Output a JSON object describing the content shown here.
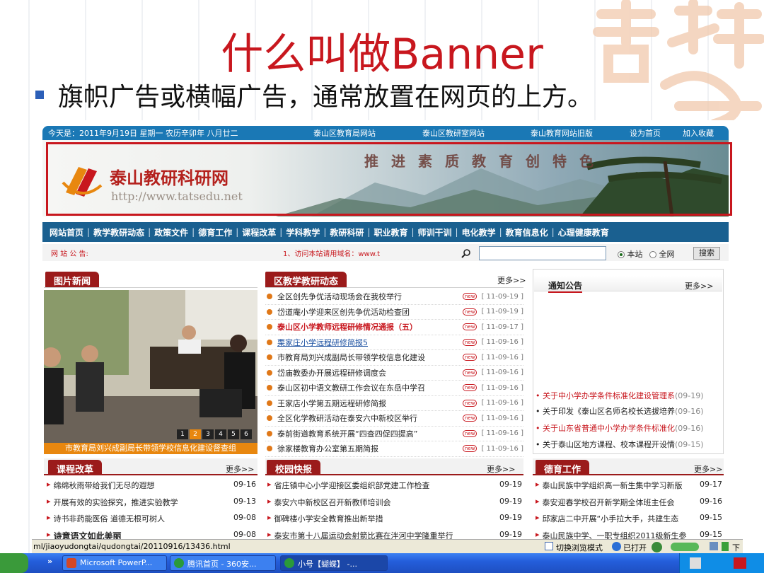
{
  "slide": {
    "title": "什么叫做Banner",
    "bullet": "旗帜广告或横幅广告，通常放置在网页的上方。"
  },
  "site": {
    "topbar": {
      "date": "今天是：2011年9月19日  星期一  农历辛卯年 八月廿二",
      "links": [
        "泰山区教育局网站",
        "泰山区教研室网站",
        "泰山教育网站旧版",
        "设为首页",
        "加入收藏"
      ]
    },
    "banner": {
      "name": "泰山教研科研网",
      "url": "http://www.tatsedu.net",
      "slogan": "推进素质教育创特色"
    },
    "nav": [
      "网站首页",
      "教学教研动态",
      "政策文件",
      "德育工作",
      "课程改革",
      "学科教学",
      "教研科研",
      "职业教育",
      "师训干训",
      "电化教学",
      "教育信息化",
      "心理健康教育"
    ],
    "notice": {
      "label": "网 站 公 告:",
      "text": "1、访问本站请用域名：www.t",
      "scope_site": "本站",
      "scope_web": "全网",
      "search": "搜索"
    },
    "photo_news": {
      "header": "图片新闻",
      "caption": "市教育局刘兴成副局长带领学校信息化建设督查组",
      "pages": [
        "1",
        "2",
        "3",
        "4",
        "5",
        "6"
      ]
    },
    "district_news": {
      "header": "区教学教研动态",
      "more": "更多>>",
      "new_label": "new",
      "items": [
        {
          "title": "全区创先争优活动现场会在我校举行",
          "date": "[ 11-09-19 ]"
        },
        {
          "title": "岱道庵小学迎来区创先争优活动检查团",
          "date": "[ 11-09-19 ]"
        },
        {
          "title": "泰山区小学教师远程研修情况通报（五）",
          "date": "[ 11-09-17 ]"
        },
        {
          "title": "栗家庄小学远程研修简报5",
          "date": "[ 11-09-16 ]"
        },
        {
          "title": "市教育局刘兴成副局长带领学校信息化建设",
          "date": "[ 11-09-16 ]"
        },
        {
          "title": "岱庙教委办开展远程研修调度会",
          "date": "[ 11-09-16 ]"
        },
        {
          "title": "泰山区初中语文教研工作会议在东岳中学召",
          "date": "[ 11-09-16 ]"
        },
        {
          "title": "王家店小学第五期远程研修简报",
          "date": "[ 11-09-16 ]"
        },
        {
          "title": "全区化学教研活动在泰安六中新校区举行",
          "date": "[ 11-09-16 ]"
        },
        {
          "title": "泰前街道教育系统开展“四查四促四提高”",
          "date": "[ 11-09-16 ]"
        },
        {
          "title": "徐家楼教育办公室第五期简报",
          "date": "[ 11-09-16 ]"
        }
      ]
    },
    "announcements": {
      "header": "通知公告",
      "more": "更多>>",
      "items": [
        {
          "title": "• 关于中小学办学条件标准化建设管理系",
          "date": "(09-19)"
        },
        {
          "title": "• 关于印发《泰山区名师名校长选拔培养",
          "date": "(09-16)"
        },
        {
          "title": "• 关于山东省普通中小学办学条件标准化",
          "date": "(09-16)"
        },
        {
          "title": "• 关于泰山区地方课程、校本课程开设情",
          "date": "(09-15)"
        }
      ]
    },
    "curriculum": {
      "header": "课程改革",
      "more": "更多>>",
      "items": [
        {
          "title": "绵绵秋雨带给我们无尽的遐想",
          "date": "09-16"
        },
        {
          "title": "开展有效的实验探究，推进实验教学",
          "date": "09-13"
        },
        {
          "title": "诗书非药能医俗 道德无根可树人",
          "date": "09-08"
        },
        {
          "title": "诗意语文如此美丽",
          "date": "09-08"
        }
      ]
    },
    "campus": {
      "header": "校园快报",
      "more": "更多>>",
      "items": [
        {
          "title": "省庄镇中心小学迎接区委组织部党建工作检查",
          "date": "09-19"
        },
        {
          "title": "泰安六中新校区召开新教师培训会",
          "date": "09-19"
        },
        {
          "title": "御碑楼小学安全教育推出新举措",
          "date": "09-19"
        },
        {
          "title": "泰安市第十八届运动会射箭比赛在泮河中学隆重举行",
          "date": "09-19"
        }
      ]
    },
    "moral": {
      "header": "德育工作",
      "more": "更多>>",
      "items": [
        {
          "title": "泰山民族中学组织高一新生集中学习新版",
          "date": "09-17"
        },
        {
          "title": "泰安迎春学校召开新学期全体班主任会",
          "date": "09-16"
        },
        {
          "title": "邱家店二中开展“小手拉大手，共建生态",
          "date": "09-15"
        },
        {
          "title": "泰山民族中学、一职专组织2011级新生参",
          "date": "09-15"
        }
      ]
    }
  },
  "browser": {
    "status_url": "ml/jiaoyudongtai/qudongtai/20110916/13436.html",
    "switch_mode": "切换浏览模式",
    "opened": "已打开",
    "down": "下"
  },
  "taskbar": {
    "tasks": [
      "Microsoft PowerP...",
      "腾讯首页 - 360安...",
      "小号【蝴蝶】 -..."
    ],
    "chevron": "»"
  },
  "colors": {
    "title_red": "#c8171e",
    "nav_blue": "#1a6090",
    "tab_red": "#9b1b1b",
    "orange": "#e8870f"
  }
}
